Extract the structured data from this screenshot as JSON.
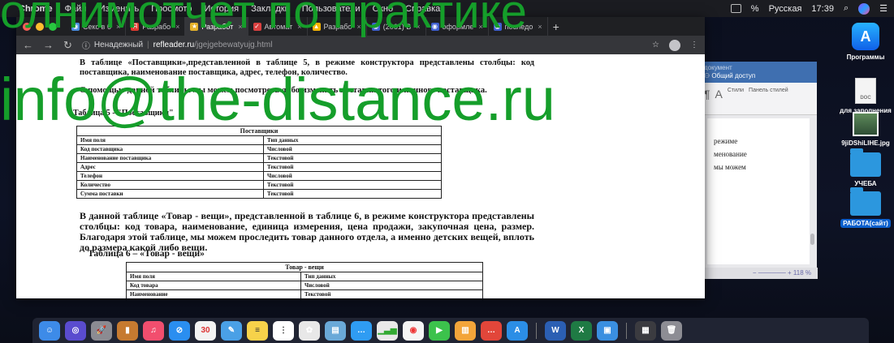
{
  "menubar": {
    "apple": "",
    "app": "Chrome",
    "items": [
      "Файл",
      "Изменить",
      "Просмотр",
      "История",
      "Закладки",
      "Пользователи",
      "Окно",
      "Справка"
    ],
    "battery": "%",
    "input_source": "Русская",
    "clock": "17:39"
  },
  "chrome": {
    "tabs": [
      {
        "label": "Секс в б",
        "color": "#4a8de0",
        "glyph": "◉"
      },
      {
        "label": "Разрабо",
        "color": "#e03b30",
        "glyph": "Я"
      },
      {
        "label": "Разработ",
        "color": "#e6b22a",
        "glyph": "★",
        "active": true
      },
      {
        "label": "Автомат",
        "color": "#d94040",
        "glyph": "✓"
      },
      {
        "label": "Разрабо",
        "color": "#f6b400",
        "glyph": "▲"
      },
      {
        "label": "(2061) В",
        "color": "#3f5fd0",
        "glyph": "◉"
      },
      {
        "label": "оформле",
        "color": "#3f5fd0",
        "glyph": "◉"
      },
      {
        "label": "последо",
        "color": "#3f5fd0",
        "glyph": "◉"
      }
    ],
    "address": {
      "security": "Ненадежный",
      "host": "refleader.ru",
      "path": "/jgejgebewatyujg.html"
    }
  },
  "doc": {
    "p1": "В таблице «Поставщики»,представленной в таблице 5, в режиме конструктора представлены столбцы: код поставщика, наименование поставщика, адрес, телефон, количество.",
    "p2": "С помощью данной таблицы мы можем посмотреть либо изменить поставки того или иного поставщика.",
    "caption1": "Таблица 5 - \"Поставщики\"",
    "table1": {
      "title": "Поставщики",
      "header": [
        "Имя поля",
        "Тип данных"
      ],
      "rows": [
        [
          "Код поставщика",
          "Числовой"
        ],
        [
          "Наименование поставщика",
          "Текстовой"
        ],
        [
          "Адрес",
          "Текстовой"
        ],
        [
          "Телефон",
          "Числовой"
        ],
        [
          "Количество",
          "Текстовой"
        ],
        [
          "Сумма поставки",
          "Текстовой"
        ]
      ]
    },
    "p3": "В данной таблице «Товар - вещи», представленной в таблице 6, в режиме конструктора представлены столбцы: код товара, наименование, единица измерения, цена продажи, закупочная цена, размер. Благодаря этой таблице, мы можем проследить товар данного отдела, а именно детских вещей, вплоть до размера какой либо вещи.",
    "caption2": "Таблица 6 – «Товар - вещи»",
    "table2": {
      "title": "Товар - вещи",
      "header": [
        "Имя поля",
        "Тип данных"
      ],
      "rows": [
        [
          "Код товара",
          "Числовой"
        ],
        [
          "Наименование",
          "Текстовой"
        ]
      ]
    }
  },
  "word": {
    "doc_title": "документ",
    "share": "Общий доступ",
    "ribbon_styles": "Стили",
    "ribbon_pane": "Панель стилей",
    "lines": [
      "режиме",
      "менование",
      "мы можем"
    ],
    "zoom": "118 %"
  },
  "desktop": {
    "icons": [
      "Программы",
      "для заполнения",
      "9jiDShiLIHE.jpg",
      "УЧЕБА",
      "РАБОТА(сайт)"
    ],
    "docfile_badge": "DOC"
  },
  "watermark": {
    "line1": "олнимотчет по практике",
    "line2": "info@the-distance.ru"
  },
  "colors": {
    "watermark": "#159e2a",
    "chrome_dark": "#35363a"
  }
}
